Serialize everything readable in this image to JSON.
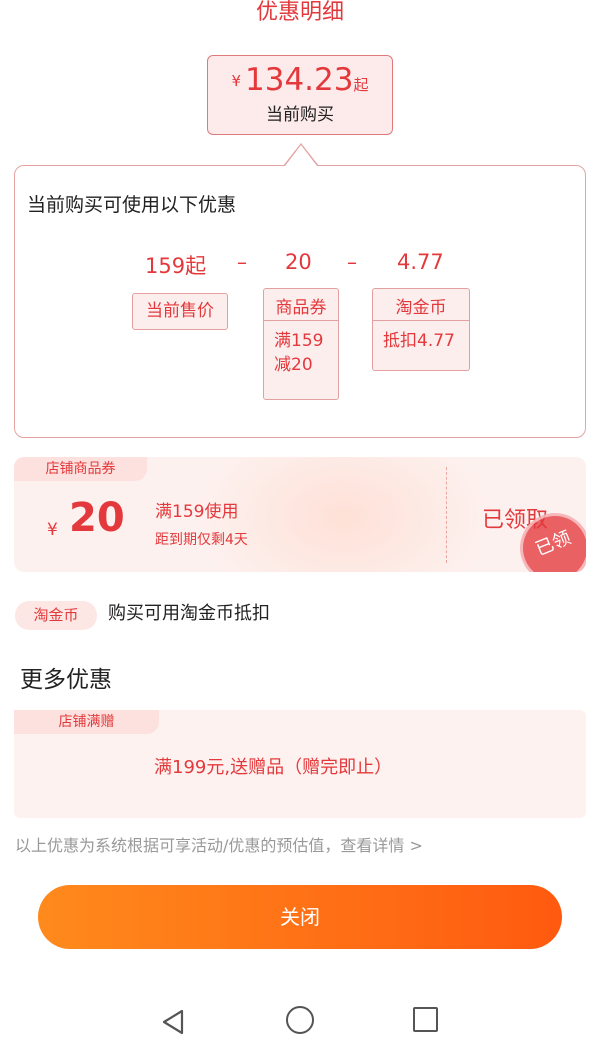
{
  "header": {
    "title": "优惠明细"
  },
  "price_bubble": {
    "currency": "¥",
    "price": "134.23",
    "suffix": "起",
    "subtitle": "当前购买"
  },
  "detail": {
    "heading": "当前购买可使用以下优惠",
    "calc": {
      "base": "159起",
      "minus1": "–",
      "coupon": "20",
      "minus2": "–",
      "coin": "4.77"
    },
    "tags": {
      "price_label": "当前售价",
      "coupon_head": "商品券",
      "coupon_body_1": "满159",
      "coupon_body_2": "减20",
      "coin_head": "淘金币",
      "coin_body": "抵扣4.77"
    }
  },
  "store_coupon": {
    "label": "店铺商品券",
    "currency": "¥",
    "amount": "20",
    "condition": "满159使用",
    "expire": "距到期仅剩4天",
    "status": "已领取",
    "stamp": "已领"
  },
  "taojinbi": {
    "badge": "淘金币",
    "text": "购买可用淘金币抵扣"
  },
  "more": {
    "title": "更多优惠",
    "gift_label": "店铺满赠",
    "gift_text": "满199元,送赠品（赠完即止）"
  },
  "note": "以上优惠为系统根据可享活动/优惠的预估值，查看详情 >",
  "close_button": "关闭",
  "nav": {
    "icons": [
      "back-icon",
      "home-icon",
      "recent-apps-icon"
    ]
  },
  "colors": {
    "accent": "#e4393c",
    "button_start": "#ff8a1c",
    "button_end": "#ff5a10"
  }
}
